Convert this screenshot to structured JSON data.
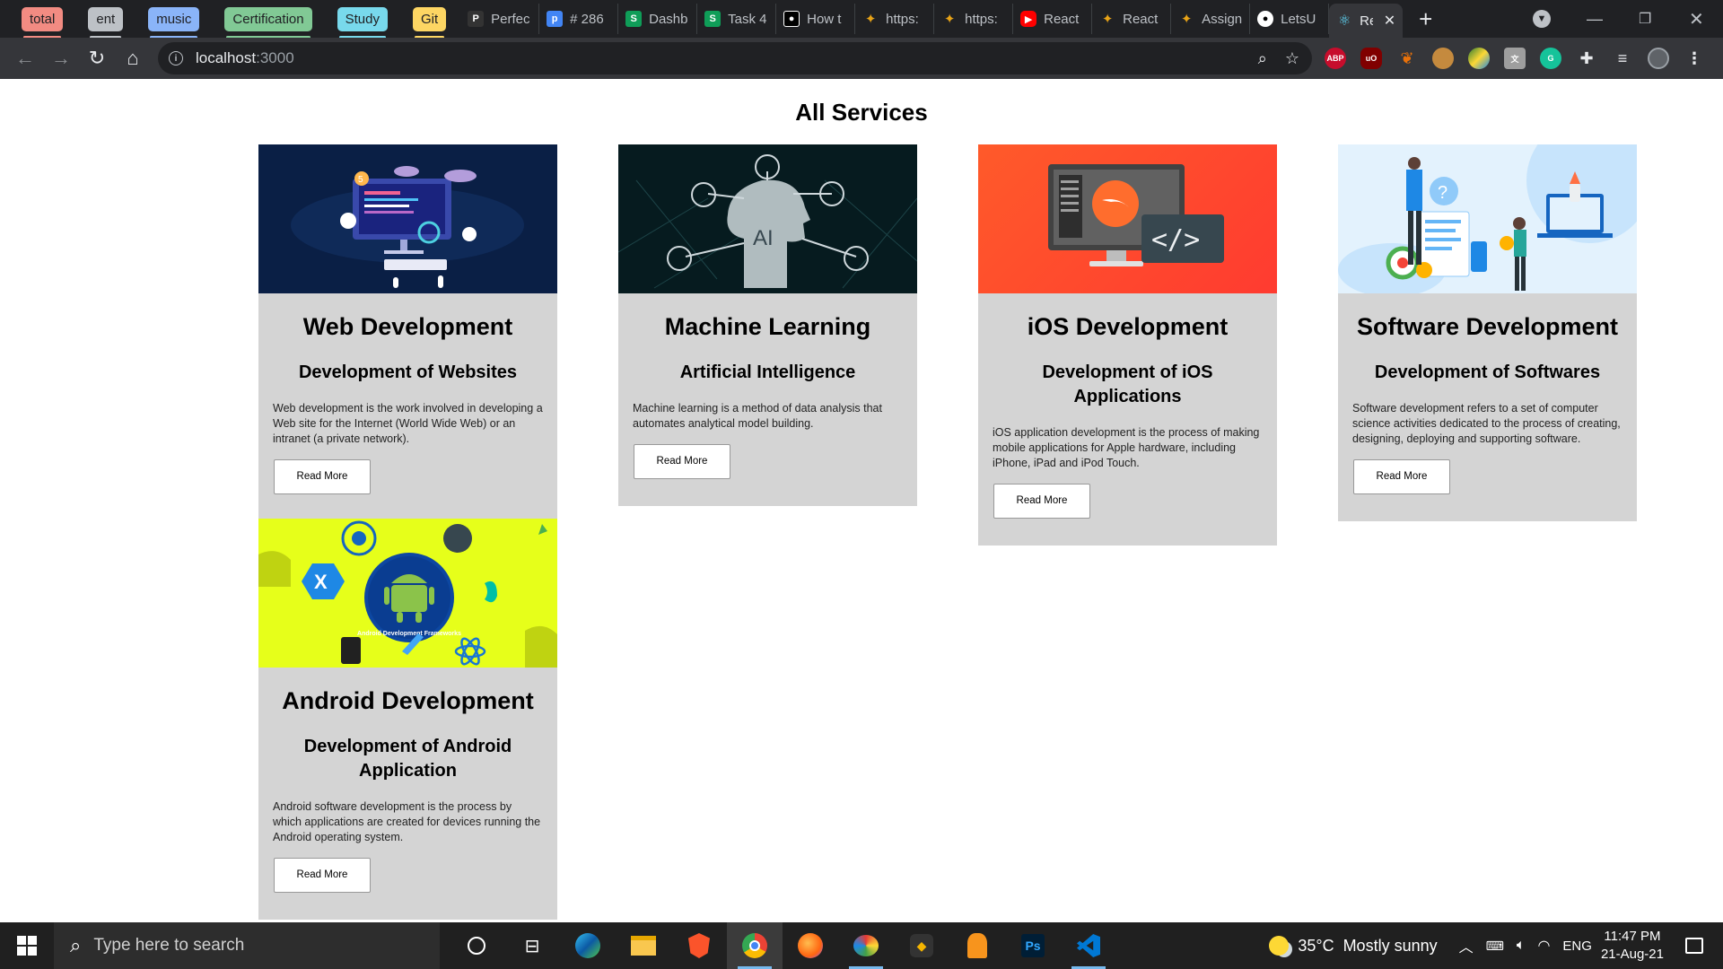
{
  "browser": {
    "tab_groups": [
      {
        "label": "total",
        "color": "#f28b82"
      },
      {
        "label": "ent",
        "color": "#bdc1c6"
      },
      {
        "label": "music",
        "color": "#8ab4f8"
      },
      {
        "label": "Certification",
        "color": "#81c995"
      },
      {
        "label": "Study",
        "color": "#78d9ec"
      },
      {
        "label": "Git",
        "color": "#fdd663"
      }
    ],
    "tabs": [
      {
        "title": "Perfec",
        "icon": "pycharm-icon",
        "color": "#333"
      },
      {
        "title": "# 286",
        "icon": "p-icon",
        "color": "#4285f4"
      },
      {
        "title": "Dashb",
        "icon": "s-icon",
        "color": "#0f9d58"
      },
      {
        "title": "Task 4",
        "icon": "s-icon",
        "color": "#0f9d58"
      },
      {
        "title": "How t",
        "icon": "medium-icon",
        "color": "#000"
      },
      {
        "title": "https:",
        "icon": "tool-icon",
        "color": "#e8a317"
      },
      {
        "title": "https:",
        "icon": "tool-icon",
        "color": "#e8a317"
      },
      {
        "title": "React",
        "icon": "youtube-icon",
        "color": "#ff0000"
      },
      {
        "title": "React",
        "icon": "tool-icon",
        "color": "#e8a317"
      },
      {
        "title": "Assign",
        "icon": "tool-icon",
        "color": "#e8a317"
      },
      {
        "title": "LetsU",
        "icon": "github-icon",
        "color": "#fff"
      }
    ],
    "active_tab": {
      "title": "Re",
      "icon": "react-icon"
    },
    "address": {
      "host": "localhost",
      "port": ":3000"
    },
    "extensions": [
      {
        "name": "abp-icon",
        "label": "ABP",
        "color": "#c70d2c"
      },
      {
        "name": "ublock-icon",
        "label": "uO",
        "color": "#800000"
      },
      {
        "name": "carrot-icon",
        "label": "",
        "color": "#e8710a"
      },
      {
        "name": "cookie-icon",
        "label": "",
        "color": "#c58a3e"
      },
      {
        "name": "colorzilla-icon",
        "label": "",
        "color": "#2e7d32"
      },
      {
        "name": "translate-icon",
        "label": "",
        "color": "#9e9e9e"
      },
      {
        "name": "grammarly-icon",
        "label": "G",
        "color": "#15c39a"
      }
    ]
  },
  "page": {
    "title": "All Services",
    "services": [
      {
        "title": "Web Development",
        "subtitle": "Development of Websites",
        "description": "Web development is the work involved in developing a Web site for the Internet (World Wide Web) or an intranet (a private network).",
        "button": "Read More",
        "image": "web-dev-image"
      },
      {
        "title": "Machine Learning",
        "subtitle": "Artificial Intelligence",
        "description": "Machine learning is a method of data analysis that automates analytical model building.",
        "button": "Read More",
        "image": "ai-head-image"
      },
      {
        "title": "iOS Development",
        "subtitle": "Development of iOS Applications",
        "description": "iOS application development is the process of making mobile applications for Apple hardware, including iPhone, iPad and iPod Touch.",
        "button": "Read More",
        "image": "swift-code-image"
      },
      {
        "title": "Software Development",
        "subtitle": "Development of Softwares",
        "description": "Software development refers to a set of computer science activities dedicated to the process of creating, designing, deploying and supporting software.",
        "button": "Read More",
        "image": "software-team-image"
      },
      {
        "title": "Android Development",
        "subtitle": "Development of Android Application",
        "description": "Android software development is the process by which applications are created for devices running the Android operating system.",
        "button": "Read More",
        "image": "android-frameworks-image",
        "image_caption": "Android Development Frameworks"
      }
    ]
  },
  "taskbar": {
    "search_placeholder": "Type here to search",
    "weather": {
      "temp": "35°C",
      "condition": "Mostly sunny"
    },
    "language": "ENG",
    "time": "11:47 PM",
    "date": "21-Aug-21"
  }
}
